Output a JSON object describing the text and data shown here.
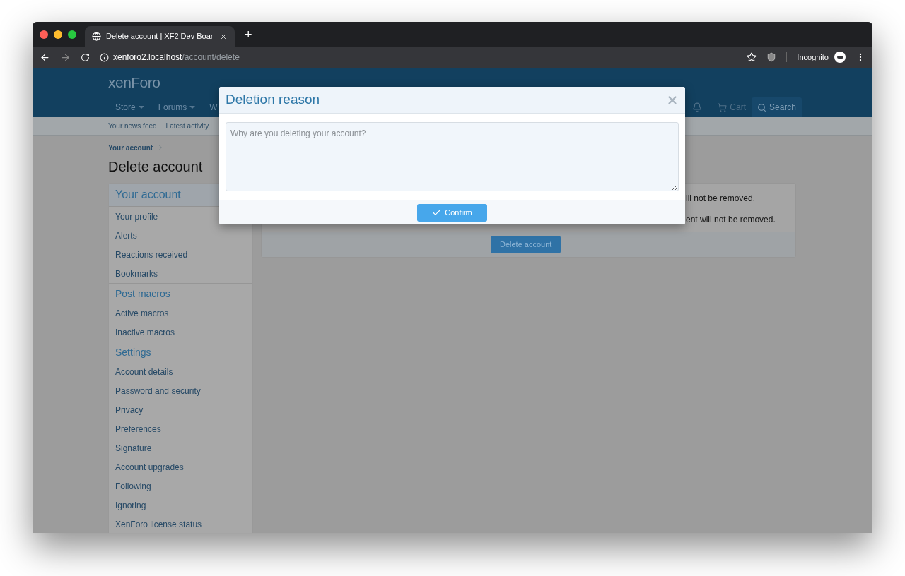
{
  "browser": {
    "tab": {
      "title": "Delete account | XF2 Dev Boar",
      "selected": true
    },
    "new_tab": "+",
    "url": {
      "host": "xenforo2.localhost",
      "path": "/account/delete"
    },
    "profile": "Incognito"
  },
  "site": {
    "logo": {
      "light": "xen",
      "bold": "Foro"
    },
    "nav": [
      {
        "label": "Store",
        "dropdown": true
      },
      {
        "label": "Forums",
        "dropdown": true
      },
      {
        "label": "W",
        "dropdown": false
      }
    ],
    "nav_right": [
      {
        "label": "Cart",
        "kind": "cart"
      },
      {
        "label": "Search",
        "kind": "search"
      }
    ],
    "subnav": [
      "Your news feed",
      "Latest activity"
    ]
  },
  "breadcrumb": [
    "Your account"
  ],
  "page_title": "Delete account",
  "sidebar": [
    {
      "title": "Your account",
      "items": [
        "Your profile",
        "Alerts",
        "Reactions received",
        "Bookmarks"
      ]
    },
    {
      "title": "Post macros",
      "items": [
        "Active macros",
        "Inactive macros"
      ]
    },
    {
      "title": "Settings",
      "items": [
        "Account details",
        "Password and security",
        "Privacy",
        "Preferences",
        "Signature",
        "Account upgrades",
        "Following",
        "Ignoring",
        "XenForo license status"
      ]
    }
  ],
  "notice_lines": [
    "ill not be removed.",
    "ent will not be removed."
  ],
  "delete_button": "Delete account",
  "dialog": {
    "title": "Deletion reason",
    "placeholder": "Why are you deleting your account?",
    "confirm": "Confirm"
  }
}
